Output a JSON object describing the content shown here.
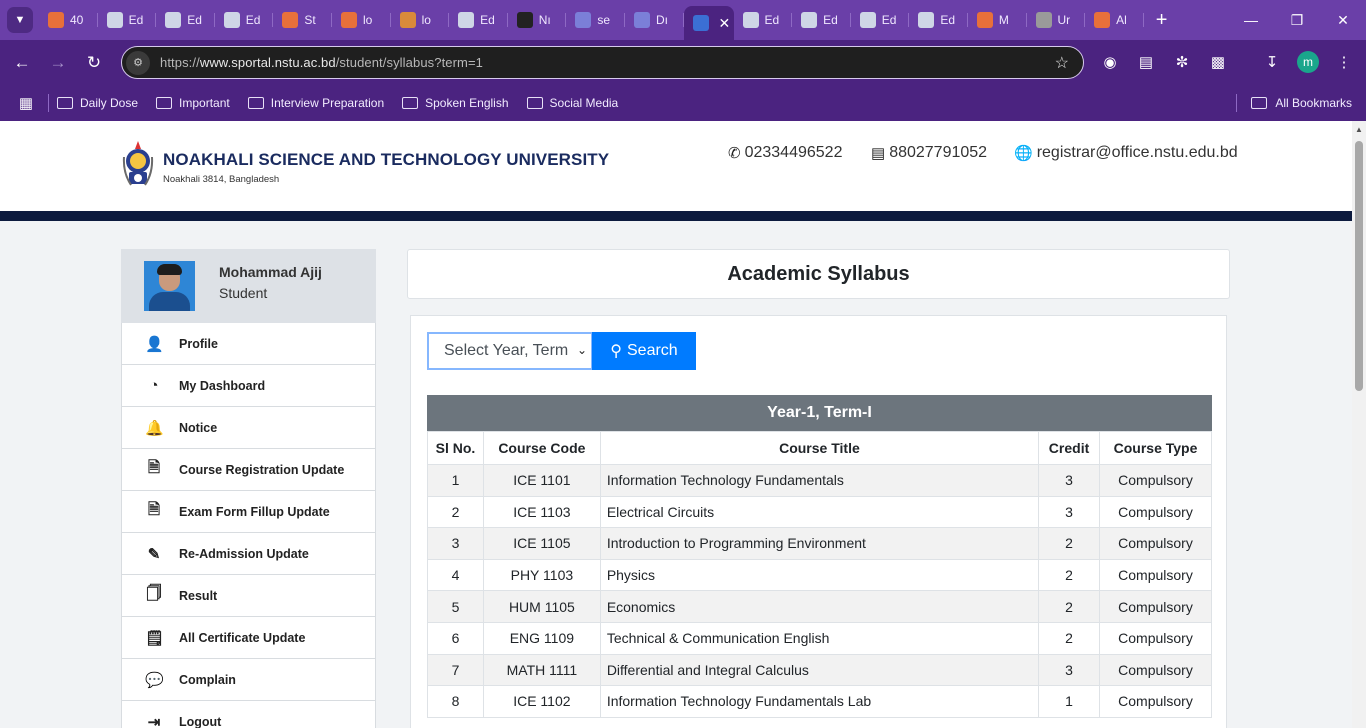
{
  "browser": {
    "tabs": [
      {
        "label": "40",
        "color": "#e8703a"
      },
      {
        "label": "Ed",
        "color": "#cfd6e6"
      },
      {
        "label": "Ed",
        "color": "#cfd6e6"
      },
      {
        "label": "Ed",
        "color": "#cfd6e6"
      },
      {
        "label": "St",
        "color": "#e8703a"
      },
      {
        "label": "lo",
        "color": "#e8703a"
      },
      {
        "label": "lo",
        "color": "#d98a3a"
      },
      {
        "label": "Ed",
        "color": "#cfd6e6"
      },
      {
        "label": "Nı",
        "color": "#222222"
      },
      {
        "label": "se",
        "color": "#7b7fd8"
      },
      {
        "label": "Dı",
        "color": "#7b7fd8"
      }
    ],
    "active_tab_color": "#3b6fd4",
    "tabs_after": [
      {
        "label": "Ed",
        "color": "#cfd6e6"
      },
      {
        "label": "Ed",
        "color": "#cfd6e6"
      },
      {
        "label": "Ed",
        "color": "#cfd6e6"
      },
      {
        "label": "Ed",
        "color": "#cfd6e6"
      },
      {
        "label": "M",
        "color": "#e8703a"
      },
      {
        "label": "Ur",
        "color": "#9a9a9a"
      },
      {
        "label": "Al",
        "color": "#e8703a"
      }
    ],
    "url_prefix": "https://",
    "url_host": "www.sportal.nstu.ac.bd",
    "url_path": "/student/syllabus?term=1",
    "profile_initial": "m",
    "bookmarks": [
      "Daily Dose",
      "Important",
      "Interview Preparation",
      "Spoken English",
      "Social Media"
    ],
    "all_bookmarks": "All Bookmarks"
  },
  "site": {
    "name": "NOAKHALI SCIENCE AND TECHNOLOGY UNIVERSITY",
    "address": "Noakhali 3814, Bangladesh",
    "phone": "02334496522",
    "fax": "88027791052",
    "email": "registrar@office.nstu.edu.bd"
  },
  "user": {
    "name": "Mohammad Ajij",
    "role": "Student"
  },
  "menu": [
    {
      "label": "Profile",
      "icon": "user-icon"
    },
    {
      "label": "My Dashboard",
      "icon": "dashboard-icon"
    },
    {
      "label": "Notice",
      "icon": "bell-icon"
    },
    {
      "label": "Course Registration Update",
      "icon": "file-icon"
    },
    {
      "label": "Exam Form Fillup Update",
      "icon": "file-icon"
    },
    {
      "label": "Re-Admission Update",
      "icon": "edit-icon"
    },
    {
      "label": "Result",
      "icon": "note-icon"
    },
    {
      "label": "All Certificate Update",
      "icon": "certificate-icon"
    },
    {
      "label": "Complain",
      "icon": "comments-icon"
    },
    {
      "label": "Logout",
      "icon": "logout-icon"
    }
  ],
  "main": {
    "title": "Academic Syllabus",
    "select_placeholder": "Select Year, Term",
    "search_label": "Search",
    "table_caption": "Year-1, Term-I",
    "columns": [
      "Sl No.",
      "Course Code",
      "Course Title",
      "Credit",
      "Course Type"
    ],
    "rows": [
      [
        "1",
        "ICE 1101",
        "Information Technology Fundamentals",
        "3",
        "Compulsory"
      ],
      [
        "2",
        "ICE 1103",
        "Electrical Circuits",
        "3",
        "Compulsory"
      ],
      [
        "3",
        "ICE 1105",
        "Introduction to Programming Environment",
        "2",
        "Compulsory"
      ],
      [
        "4",
        "PHY 1103",
        "Physics",
        "2",
        "Compulsory"
      ],
      [
        "5",
        "HUM 1105",
        "Economics",
        "2",
        "Compulsory"
      ],
      [
        "6",
        "ENG 1109",
        "Technical & Communication English",
        "2",
        "Compulsory"
      ],
      [
        "7",
        "MATH 1111",
        "Differential and Integral Calculus",
        "3",
        "Compulsory"
      ],
      [
        "8",
        "ICE 1102",
        "Information Technology Fundamentals Lab",
        "1",
        "Compulsory"
      ]
    ]
  }
}
